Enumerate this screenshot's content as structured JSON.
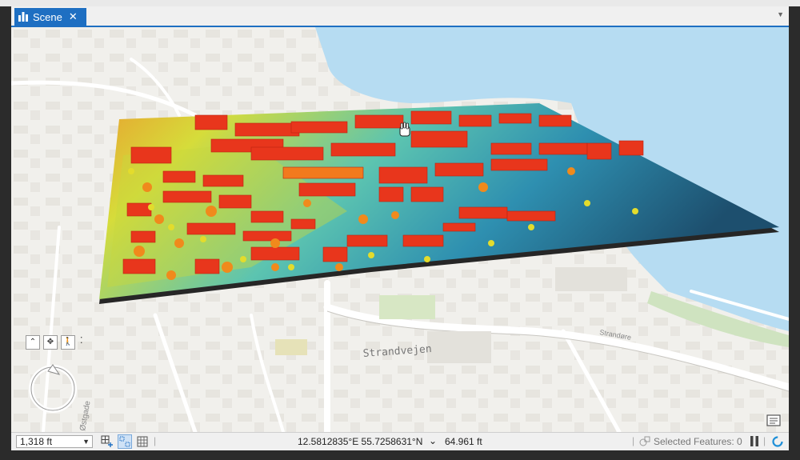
{
  "tab": {
    "title": "Scene"
  },
  "map": {
    "street_label": "Strandvejen",
    "street_label_2": "Strandøre",
    "side_label": "Østgade",
    "water_color": "#b6dcf2",
    "land_color": "#f1f0ec",
    "elevation_palette": [
      "#1d4f6e",
      "#2f96b3",
      "#7fd0b5",
      "#d9e34a",
      "#f5a623",
      "#e8361c"
    ]
  },
  "status": {
    "scale": "1,318 ft",
    "coordinates": "12.5812835°E 55.7258631°N",
    "elevation": "64.961 ft",
    "selected_features": "Selected Features: 0"
  }
}
